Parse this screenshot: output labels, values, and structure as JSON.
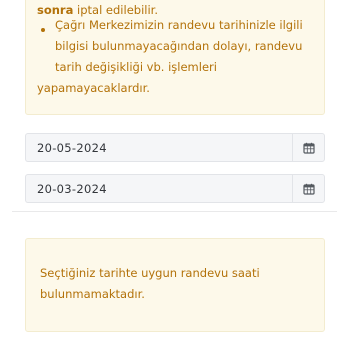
{
  "cancellation_info": {
    "line1_bold": "sonra",
    "line1_rest": " iptal edilebilir.",
    "bullet_text": "Çağrı Merkezimizin randevu tarihinizle ilgili bilgisi bulunmayacağından dolayı, randevu tarih değişikliği vb. işlemleri",
    "bullet_text_end": "yapamayacaklardır."
  },
  "date_fields": [
    {
      "value": "20-05-2024",
      "icon": "calendar-icon"
    },
    {
      "value": "20-03-2024",
      "icon": "calendar-icon"
    }
  ],
  "notice": {
    "text": "Seçtiğiniz tarihte uygun randevu saati bulunmamaktadır."
  },
  "colors": {
    "info_text": "#b3720a",
    "info_bg": "#fdf9ea",
    "input_bg": "#f5f6f8"
  }
}
